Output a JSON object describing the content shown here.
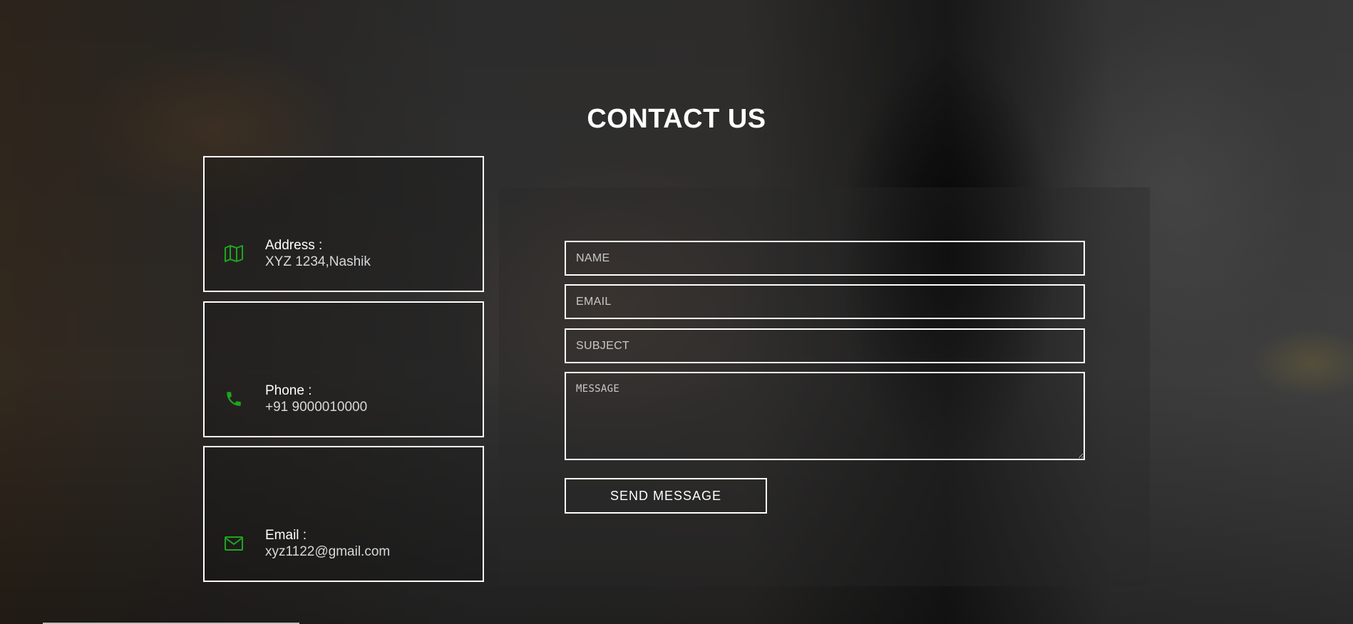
{
  "page": {
    "title": "CONTACT US"
  },
  "contact_info": {
    "address": {
      "label": "Address :",
      "value": "XYZ 1234,Nashik",
      "icon": "map-icon"
    },
    "phone": {
      "label": "Phone :",
      "value": "+91 9000010000",
      "icon": "phone-icon"
    },
    "email": {
      "label": "Email :",
      "value": "xyz1122@gmail.com",
      "icon": "envelope-icon"
    }
  },
  "form": {
    "name_placeholder": "NAME",
    "email_placeholder": "EMAIL",
    "subject_placeholder": "SUBJECT",
    "message_placeholder": "MESSAGE",
    "submit_label": "SEND MESSAGE"
  },
  "colors": {
    "accent_icon": "#1fa51f",
    "border": "#ffffff",
    "text": "#ffffff"
  }
}
